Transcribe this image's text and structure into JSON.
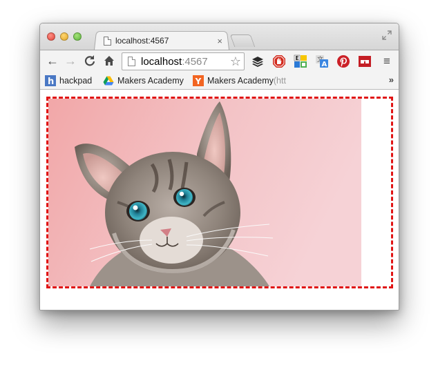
{
  "tab": {
    "title": "localhost:4567",
    "close_glyph": "×"
  },
  "toolbar": {
    "back_glyph": "←",
    "forward_glyph": "→",
    "reload_glyph": "C",
    "home_glyph": "⌂",
    "menu_glyph": "≡"
  },
  "omnibox": {
    "host": "localhost",
    "port": ":4567",
    "star_glyph": "☆"
  },
  "extensions": [
    "buffer-icon",
    "adblock-icon",
    "abbreviations-icon",
    "translate-icon",
    "pinterest-icon",
    "readability-icon"
  ],
  "bookmarks": [
    {
      "label": "hackpad",
      "icon": "hackpad-icon"
    },
    {
      "label": "Makers Academy",
      "icon": "google-drive-icon"
    },
    {
      "label": "Makers Academy",
      "suffix": " (htt",
      "icon": "y-combinator-icon"
    }
  ],
  "bookmarks_more": "»",
  "colors": {
    "dashed_border": "#e01414",
    "pinterest": "#cb2027",
    "readability": "#c41e25",
    "hackpad": "#4a78c4",
    "ycombinator": "#f26522"
  }
}
